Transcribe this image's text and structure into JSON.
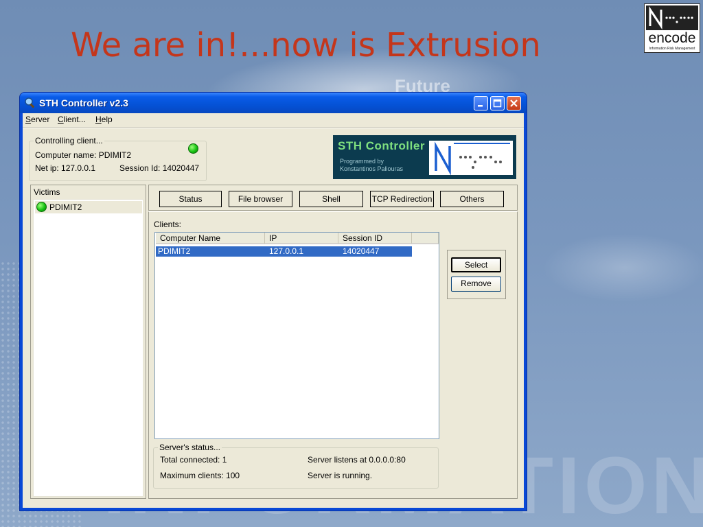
{
  "slide": {
    "title": "We are in!...now is Extrusion",
    "watermark": "INFORMATION SECURITY",
    "bg_text": "Future",
    "logo": {
      "word": "encode",
      "tagline": "Information Risk Management"
    }
  },
  "window": {
    "title": "STH Controller v2.3",
    "menu": [
      {
        "label": "Server",
        "u": "S",
        "rest": "erver"
      },
      {
        "label": "Client...",
        "u": "C",
        "rest": "lient..."
      },
      {
        "label": "Help",
        "u": "H",
        "rest": "elp"
      }
    ]
  },
  "controlling": {
    "group_title": "Controlling client...",
    "computer_name": "Computer name: PDIMIT2",
    "net_ip": "Net ip: 127.0.0.1",
    "session": "Session Id: 14020447",
    "status_color": "#17c213"
  },
  "banner": {
    "title": "STH Controller",
    "sub1": "Programmed by",
    "sub2": "Konstantinos Paliouras"
  },
  "victims": {
    "header": "Victims",
    "items": [
      "PDIMIT2"
    ]
  },
  "tabs": [
    "Status",
    "File browser",
    "Shell",
    "TCP Redirection",
    "Others"
  ],
  "clients": {
    "label": "Clients:",
    "columns": [
      "Computer Name",
      "IP",
      "Session ID"
    ],
    "rows": [
      {
        "name": "PDIMIT2",
        "ip": "127.0.0.1",
        "session": "14020447"
      }
    ],
    "buttons": {
      "select": "Select",
      "remove": "Remove"
    }
  },
  "server_status": {
    "title": "Server's status...",
    "total": "Total connected: 1",
    "max": "Maximum clients: 100",
    "listens": "Server listens at 0.0.0.0:80",
    "running": "Server is running."
  },
  "colors": {
    "title_red": "#c4361b",
    "selection": "#316ac5",
    "xp_blue": "#0a49d6"
  }
}
